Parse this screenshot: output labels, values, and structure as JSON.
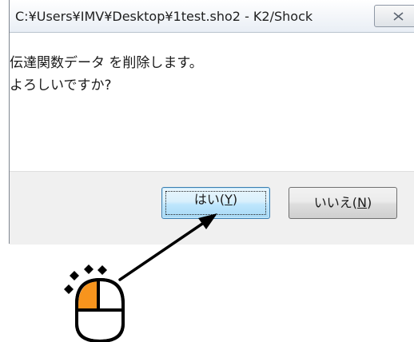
{
  "window": {
    "title": "C:¥Users¥IMV¥Desktop¥1test.sho2 - K2/Shock"
  },
  "message": {
    "line1": "伝達関数データ を削除します。",
    "line2": "よろしいですか?"
  },
  "buttons": {
    "yes": {
      "label": "はい(",
      "hotkey": "Y",
      "suffix": ")"
    },
    "no": {
      "label": "いいえ(",
      "hotkey": "N",
      "suffix": ")"
    }
  },
  "icons": {
    "close": "close-icon",
    "mouse": "mouse-left-click-icon",
    "arrow": "pointer-arrow-icon"
  },
  "colors": {
    "mouse_left_button": "#f7941d",
    "yes_button_border": "#3c7fb1",
    "dialog_background": "#f0f0f0"
  }
}
